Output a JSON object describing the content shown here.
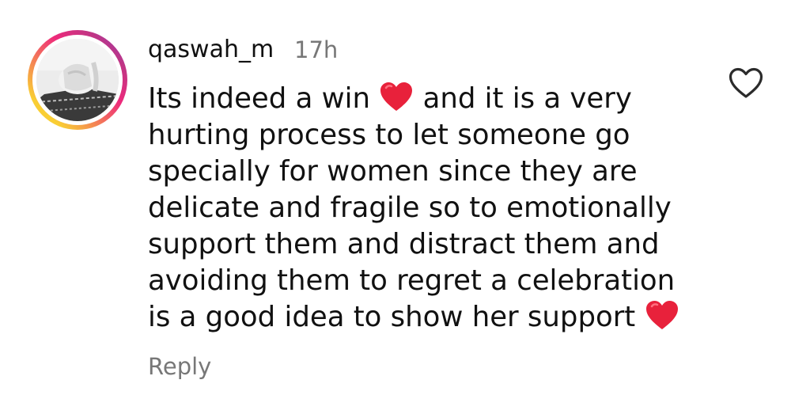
{
  "comment": {
    "username": "qaswah_m",
    "timestamp": "17h",
    "lines": [
      {
        "before": "Its indeed a win ",
        "after": " and it is a very"
      },
      {
        "text": "hurting process to let someone go"
      },
      {
        "text": "specially for women since they are"
      },
      {
        "text": "delicate and fragile so to emotionally"
      },
      {
        "text": "support them and distract them and"
      },
      {
        "text": "avoiding them to regret a celebration"
      },
      {
        "before": "is a good idea to show her support ",
        "after": ""
      }
    ],
    "reply_label": "Reply"
  },
  "icons": {
    "avatar": "profile-photo",
    "emoji": "red-heart-emoji",
    "like": "heart-outline-icon"
  },
  "colors": {
    "text": "#111111",
    "muted": "#777777",
    "heart": "#e8213b",
    "story_ring_start": "#f9ce34",
    "story_ring_end": "#8a3ab9"
  }
}
